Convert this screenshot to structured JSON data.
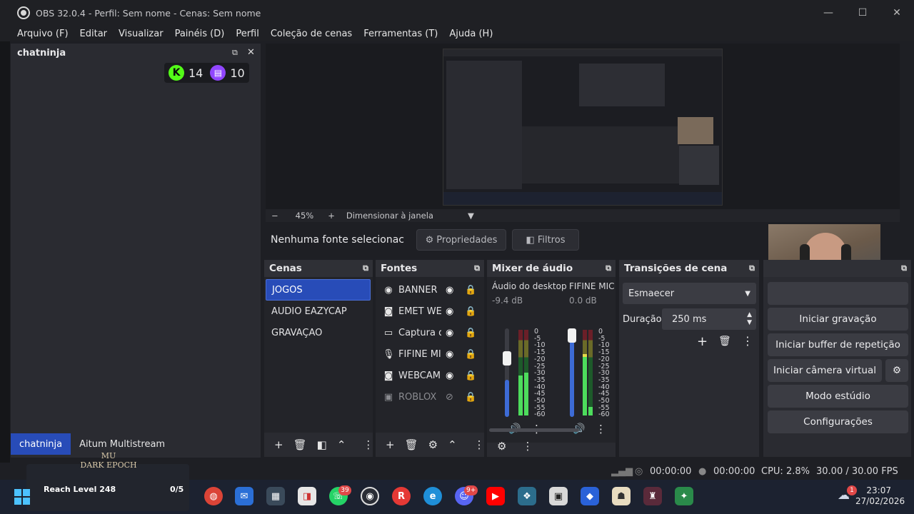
{
  "window": {
    "title": "OBS 32.0.4 - Perfil: Sem nome - Cenas: Sem nome",
    "minimize": "—",
    "maximize": "☐",
    "close": "✕"
  },
  "menu": [
    "Arquivo (F)",
    "Editar",
    "Visualizar",
    "Painéis (D)",
    "Perfil",
    "Coleção de cenas",
    "Ferramentas (T)",
    "Ajuda (H)"
  ],
  "chat_dock": {
    "title": "chatninja",
    "kick_count": "14",
    "twitch_count": "10",
    "kick_letter": "K",
    "tabs": [
      "chatninja",
      "Aitum Multistream"
    ]
  },
  "preview": {
    "zoom_minus": "−",
    "zoom": "45%",
    "zoom_plus": "+",
    "fit_label": "Dimensionar à janela"
  },
  "source_bar": {
    "no_source": "Nenhuma fonte selecionac",
    "properties": "Propriedades",
    "filters": "Filtros"
  },
  "scenes": {
    "title": "Cenas",
    "items": [
      "JOGOS",
      "AUDIO EAZYCAP",
      "GRAVAÇAO"
    ],
    "selected": 0
  },
  "sources": {
    "title": "Fontes",
    "items": [
      {
        "name": "BANNER",
        "icon": "globe-icon",
        "glyph": "◉"
      },
      {
        "name": "EMET WEE",
        "icon": "camera-icon",
        "glyph": "◙"
      },
      {
        "name": "Captura d",
        "icon": "monitor-icon",
        "glyph": "▭"
      },
      {
        "name": "FIFINE MIC",
        "icon": "microphone-icon",
        "glyph": "🎙"
      },
      {
        "name": "WEBCAM",
        "icon": "camera-icon",
        "glyph": "◙"
      },
      {
        "name": "ROBLOX",
        "icon": "window-icon",
        "glyph": "▣"
      }
    ]
  },
  "mixer": {
    "title": "Mixer de áudio",
    "channels": [
      {
        "name": "Áudio do desktop",
        "db": "-9.4 dB",
        "level": 0.42
      },
      {
        "name": "FIFINE MIC",
        "db": "0.0 dB",
        "level": 0.98
      }
    ],
    "scale": [
      "0",
      "-5",
      "-10",
      "-15",
      "-20",
      "-25",
      "-30",
      "-35",
      "-40",
      "-45",
      "-50",
      "-55",
      "-60"
    ]
  },
  "transitions": {
    "title": "Transições de cena",
    "selected": "Esmaecer",
    "duration_label": "Duração",
    "duration_value": "250 ms"
  },
  "controls": {
    "buttons": [
      "Iniciar gravação",
      "Iniciar buffer de repetição",
      "Iniciar câmera virtual",
      "Modo estúdio",
      "Configurações"
    ]
  },
  "status": {
    "rec_time": "00:00:00",
    "stream_time": "00:00:00",
    "cpu": "CPU: 2.8%",
    "fps": "30.00 / 30.00 FPS"
  },
  "taskbar": {
    "game_label": "Reach Level 248",
    "game_count": "0/5",
    "game_logo_line1": "MU",
    "game_logo_line2": "DARK EPOCH",
    "whatsapp_badge": "39",
    "discord_badge": "9+",
    "weather_badge": "1",
    "time": "23:07",
    "date": "27/02/2026"
  },
  "colors": {
    "accent": "#284cb8",
    "kick": "#53fc18",
    "twitch": "#9146ff"
  }
}
